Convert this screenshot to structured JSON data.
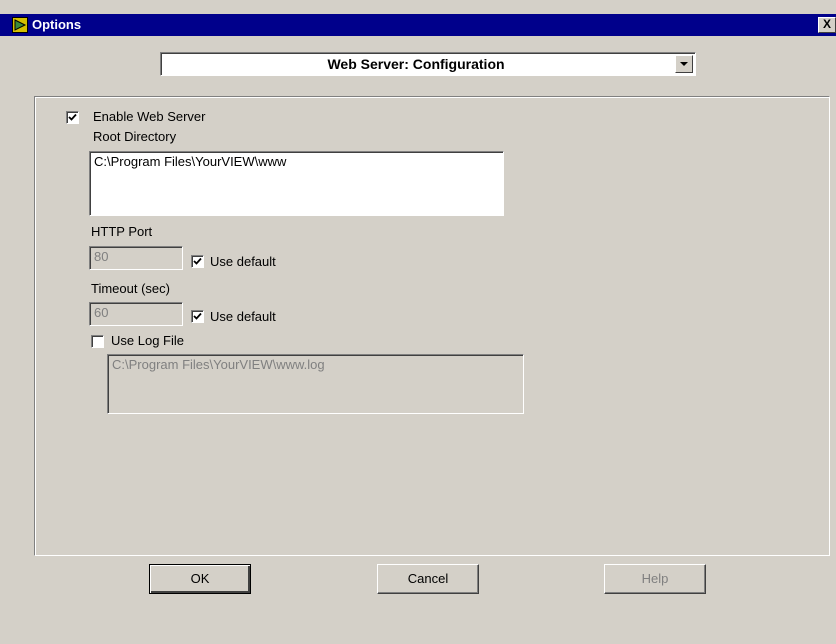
{
  "window": {
    "title": "Options",
    "close_glyph": "X",
    "icon": "options-app-icon"
  },
  "category": {
    "selected": "Web Server: Configuration"
  },
  "settings": {
    "enable_web_server": {
      "label": "Enable Web Server",
      "checked": true
    },
    "root_directory": {
      "label": "Root Directory",
      "value": "C:\\Program Files\\YourVIEW\\www"
    },
    "http_port": {
      "label": "HTTP Port",
      "value": "80",
      "use_default_label": "Use default",
      "use_default_checked": true
    },
    "timeout": {
      "label": "Timeout (sec)",
      "value": "60",
      "use_default_label": "Use default",
      "use_default_checked": true
    },
    "log_file": {
      "label": "Use Log File",
      "checked": false,
      "value": "C:\\Program Files\\YourVIEW\\www.log"
    }
  },
  "buttons": {
    "ok": "OK",
    "cancel": "Cancel",
    "help": "Help"
  },
  "colors": {
    "titlebar": "#00008b",
    "dialog_bg": "#d4d0c8",
    "disabled_text": "#808080"
  }
}
